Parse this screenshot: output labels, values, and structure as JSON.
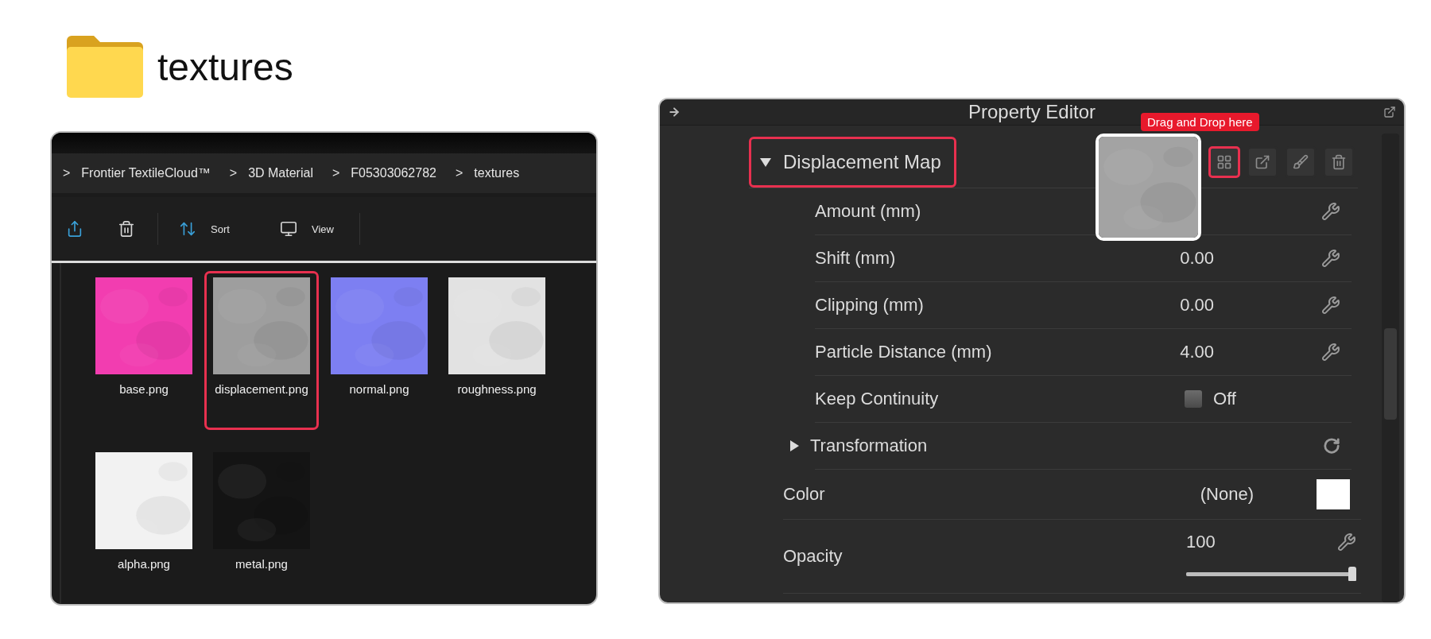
{
  "header": {
    "title": "textures"
  },
  "file_browser": {
    "breadcrumbs": [
      {
        "separator": ">",
        "label": "Frontier TextileCloud™"
      },
      {
        "separator": ">",
        "label": "3D Material"
      },
      {
        "separator": ">",
        "label": "F05303062782"
      },
      {
        "separator": ">",
        "label": "textures"
      }
    ],
    "toolbar": [
      {
        "kind": "share"
      },
      {
        "kind": "delete"
      },
      {
        "kind": "sort",
        "label": "Sort"
      },
      {
        "kind": "view",
        "label": "View"
      }
    ],
    "files": [
      {
        "name": "base.png",
        "color": "#f23db0",
        "selected": false
      },
      {
        "name": "displacement.png",
        "color": "#9e9e9e",
        "selected": true
      },
      {
        "name": "normal.png",
        "color": "#7d7ff2",
        "selected": false
      },
      {
        "name": "roughness.png",
        "color": "#e2e2e2",
        "selected": false
      },
      {
        "name": "alpha.png",
        "color": "#f2f2f2",
        "selected": false
      },
      {
        "name": "metal.png",
        "color": "#141414",
        "selected": false
      }
    ]
  },
  "property_editor": {
    "title": "Property Editor",
    "drop_hint": "Drag and Drop here",
    "section": {
      "label": "Displacement Map",
      "expanded": true,
      "highlighted": true
    },
    "tools": [
      {
        "kind": "grid",
        "highlighted": true
      },
      {
        "kind": "export",
        "highlighted": false
      },
      {
        "kind": "brush",
        "highlighted": false
      },
      {
        "kind": "delete",
        "highlighted": false
      }
    ],
    "rows": [
      {
        "kind": "number",
        "label": "Amount (mm)"
      },
      {
        "kind": "number",
        "label": "Shift (mm)",
        "value": "0.00"
      },
      {
        "kind": "number",
        "label": "Clipping (mm)",
        "value": "0.00"
      },
      {
        "kind": "number",
        "label": "Particle Distance (mm)",
        "value": "4.00"
      },
      {
        "kind": "toggle",
        "label": "Keep Continuity",
        "value": "Off",
        "checked": false
      },
      {
        "kind": "group",
        "label": "Transformation",
        "expanded": false
      }
    ],
    "color": {
      "label": "Color",
      "value": "(None)"
    },
    "opacity": {
      "label": "Opacity",
      "value": "100",
      "level": 1
    }
  }
}
